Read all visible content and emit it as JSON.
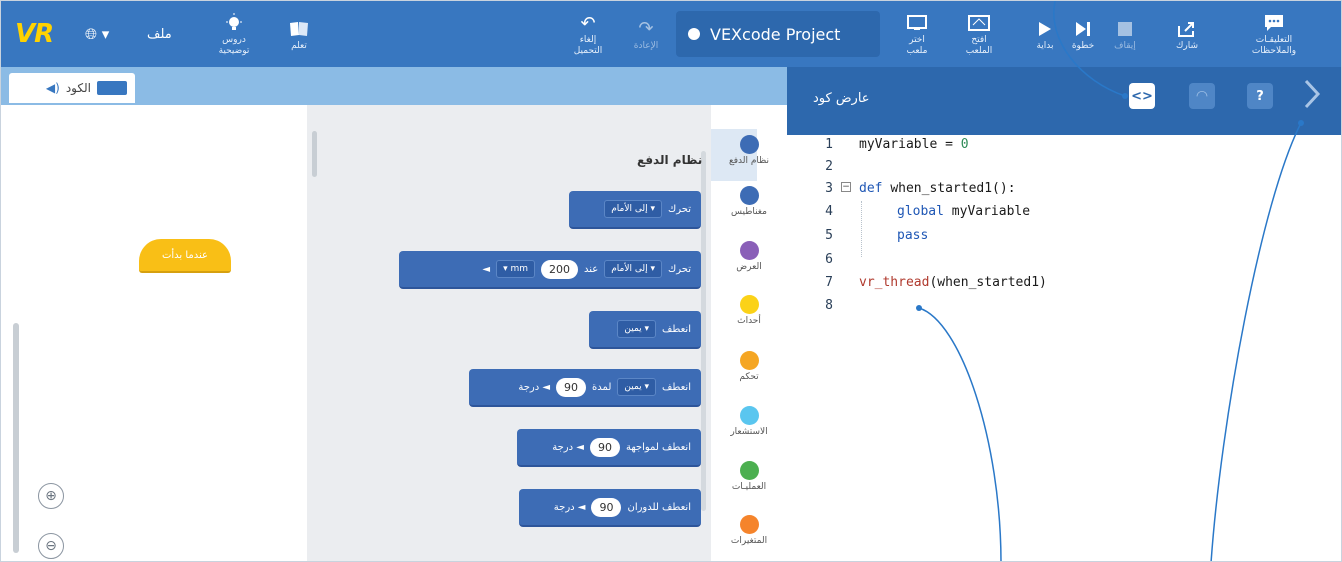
{
  "toolbar": {
    "logo": "VR",
    "file_label": "ملف",
    "tutorials_label": "دروس\nتوضيحية",
    "learn_label": "تعلم",
    "undo_label": "إلغاء\nالتحميل",
    "redo_label": "الإعادة",
    "project_name": "VEXcode Project",
    "select_playground_label": "اختر\nملعب",
    "open_playground_label": "افتح\nالملعب",
    "start_label": "بداية",
    "step_label": "خطوة",
    "stop_label": "إيقاف",
    "share_label": "شارك",
    "feedback_label": "التعليقـات\nوالملاحظات"
  },
  "code_tab": {
    "label": "الكود"
  },
  "viewer": {
    "title": "عارض كود"
  },
  "workspace": {
    "start_block": "عندما بدأت"
  },
  "palette": {
    "heading": "نظام الدفع",
    "categories": [
      {
        "label": "نظام الدفع",
        "color": "#3d6cb5"
      },
      {
        "label": "مغناطيس",
        "color": "#3d6cb5"
      },
      {
        "label": "العرض",
        "color": "#8a5fb8"
      },
      {
        "label": "أحداث",
        "color": "#fbd218"
      },
      {
        "label": "تحكم",
        "color": "#f5a623"
      },
      {
        "label": "الاستشعار",
        "color": "#5ac6ef"
      },
      {
        "label": "العمليـات",
        "color": "#4caf50"
      },
      {
        "label": "المتغيرات",
        "color": "#f5842b"
      }
    ],
    "blocks": [
      {
        "verb": "تحرك",
        "dd1": "إلى الأمام ▾"
      },
      {
        "verb": "تحرك",
        "dd1": "إلى الأمام ▾",
        "mid": "عند",
        "num": "200",
        "dd2": "▾ mm",
        "arrow": "◄"
      },
      {
        "verb": "انعطف",
        "dd1": "يمين ▾"
      },
      {
        "verb": "انعطف",
        "dd1": "يمين ▾",
        "mid": "لمدة",
        "num": "90",
        "tail": "درجة ◄"
      },
      {
        "verb": "انعطف لمواجهة",
        "num": "90",
        "tail": "درجة ◄"
      },
      {
        "verb": "انعطف للدوران",
        "num": "90",
        "tail": "درجة ◄"
      }
    ]
  },
  "code": {
    "line_numbers": [
      "1",
      "2",
      "3",
      "4",
      "5",
      "6",
      "7",
      "8"
    ],
    "l1_a": "myVariable = ",
    "l1_b": "0",
    "l3_a": "def ",
    "l3_b": "when_started1():",
    "l4_a": "global ",
    "l4_b": "myVariable",
    "l5": "pass",
    "l7_a": "vr_thread",
    "l7_b": "(when_started1)"
  }
}
